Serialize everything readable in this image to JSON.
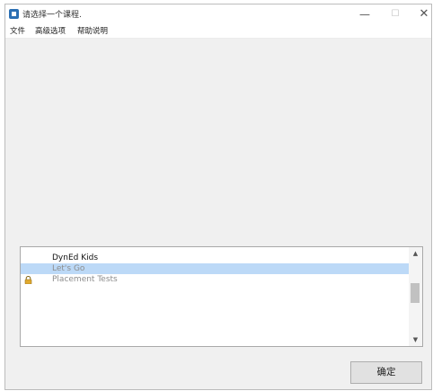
{
  "window": {
    "title": "请选择一个课程."
  },
  "title_buttons": {
    "minimize": "—",
    "maximize": "☐",
    "close": "✕"
  },
  "menu": {
    "items": [
      {
        "label": "文件"
      },
      {
        "label": "高级选项"
      },
      {
        "label": "帮助说明"
      }
    ]
  },
  "course_list": {
    "items": [
      {
        "label": "DynEd Kids",
        "state": "normal"
      },
      {
        "label": "Let's Go",
        "state": "selected"
      },
      {
        "label": "Placement Tests",
        "state": "locked",
        "icon": "lock-icon"
      }
    ],
    "scroll_up": "▲",
    "scroll_down": "▼"
  },
  "buttons": {
    "ok_label": "确定"
  },
  "colors": {
    "selection": "#bcd9f7",
    "app_icon": "#2b6fb3"
  }
}
